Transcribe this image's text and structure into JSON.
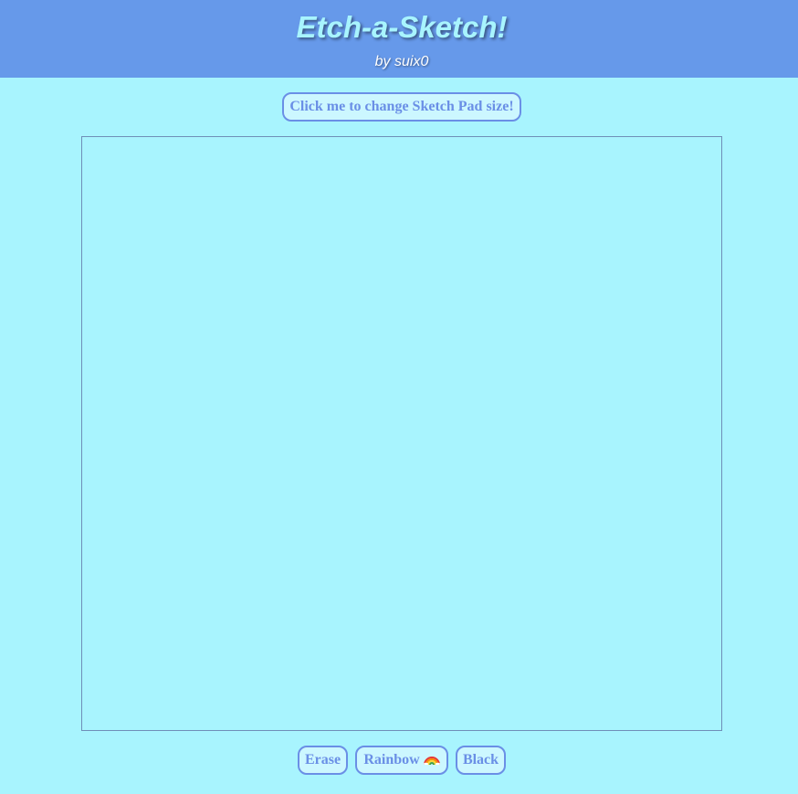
{
  "header": {
    "title": "Etch-a-Sketch!",
    "byline": "by suix0"
  },
  "controls": {
    "size_button_label": "Click me to change Sketch Pad size!",
    "erase_label": "Erase",
    "rainbow_label": "Rainbow",
    "rainbow_icon": "rainbow-icon",
    "black_label": "Black"
  },
  "colors": {
    "header_bg": "#6699ea",
    "page_bg": "#a8f4fe",
    "accent": "#6a8fe6"
  }
}
